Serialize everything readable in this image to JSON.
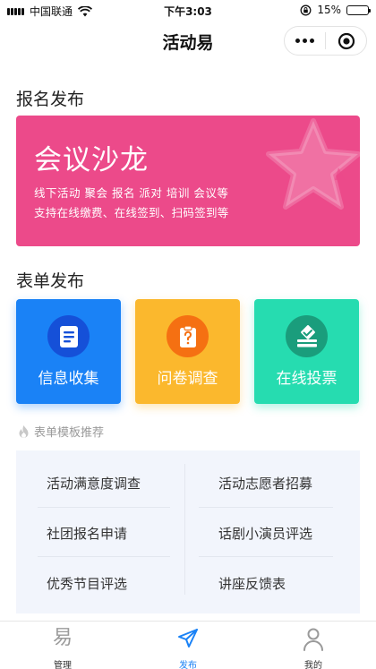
{
  "status_bar": {
    "carrier": "中国联通",
    "time": "下午3:03",
    "battery": "15%",
    "battery_level": 0.15
  },
  "nav": {
    "title": "活动易"
  },
  "sections": {
    "signup_title": "报名发布",
    "form_title": "表单发布"
  },
  "banner": {
    "title": "会议沙龙",
    "line1": "线下活动 聚会 报名 派对 培训 会议等",
    "line2": "支持在线缴费、在线签到、扫码签到等",
    "color": "#ec4a8a"
  },
  "tiles": [
    {
      "label": "信息收集",
      "icon": "document-icon",
      "color": "#1a82f6"
    },
    {
      "label": "问卷调查",
      "icon": "clipboard-question-icon",
      "color": "#fbb82d"
    },
    {
      "label": "在线投票",
      "icon": "ballot-box-icon",
      "color": "#26dcb0"
    }
  ],
  "recommend": {
    "title": "表单模板推荐",
    "icon": "flame-icon"
  },
  "templates": [
    "活动满意度调查",
    "活动志愿者招募",
    "社团报名申请",
    "话剧小演员评选",
    "优秀节目评选",
    "讲座反馈表"
  ],
  "tabbar": [
    {
      "label": "管理",
      "icon": "yi-character-icon",
      "glyph": "易",
      "active": false
    },
    {
      "label": "发布",
      "icon": "paper-plane-icon",
      "active": true
    },
    {
      "label": "我的",
      "icon": "user-icon",
      "active": false
    }
  ],
  "accent_color": "#1a82f6"
}
